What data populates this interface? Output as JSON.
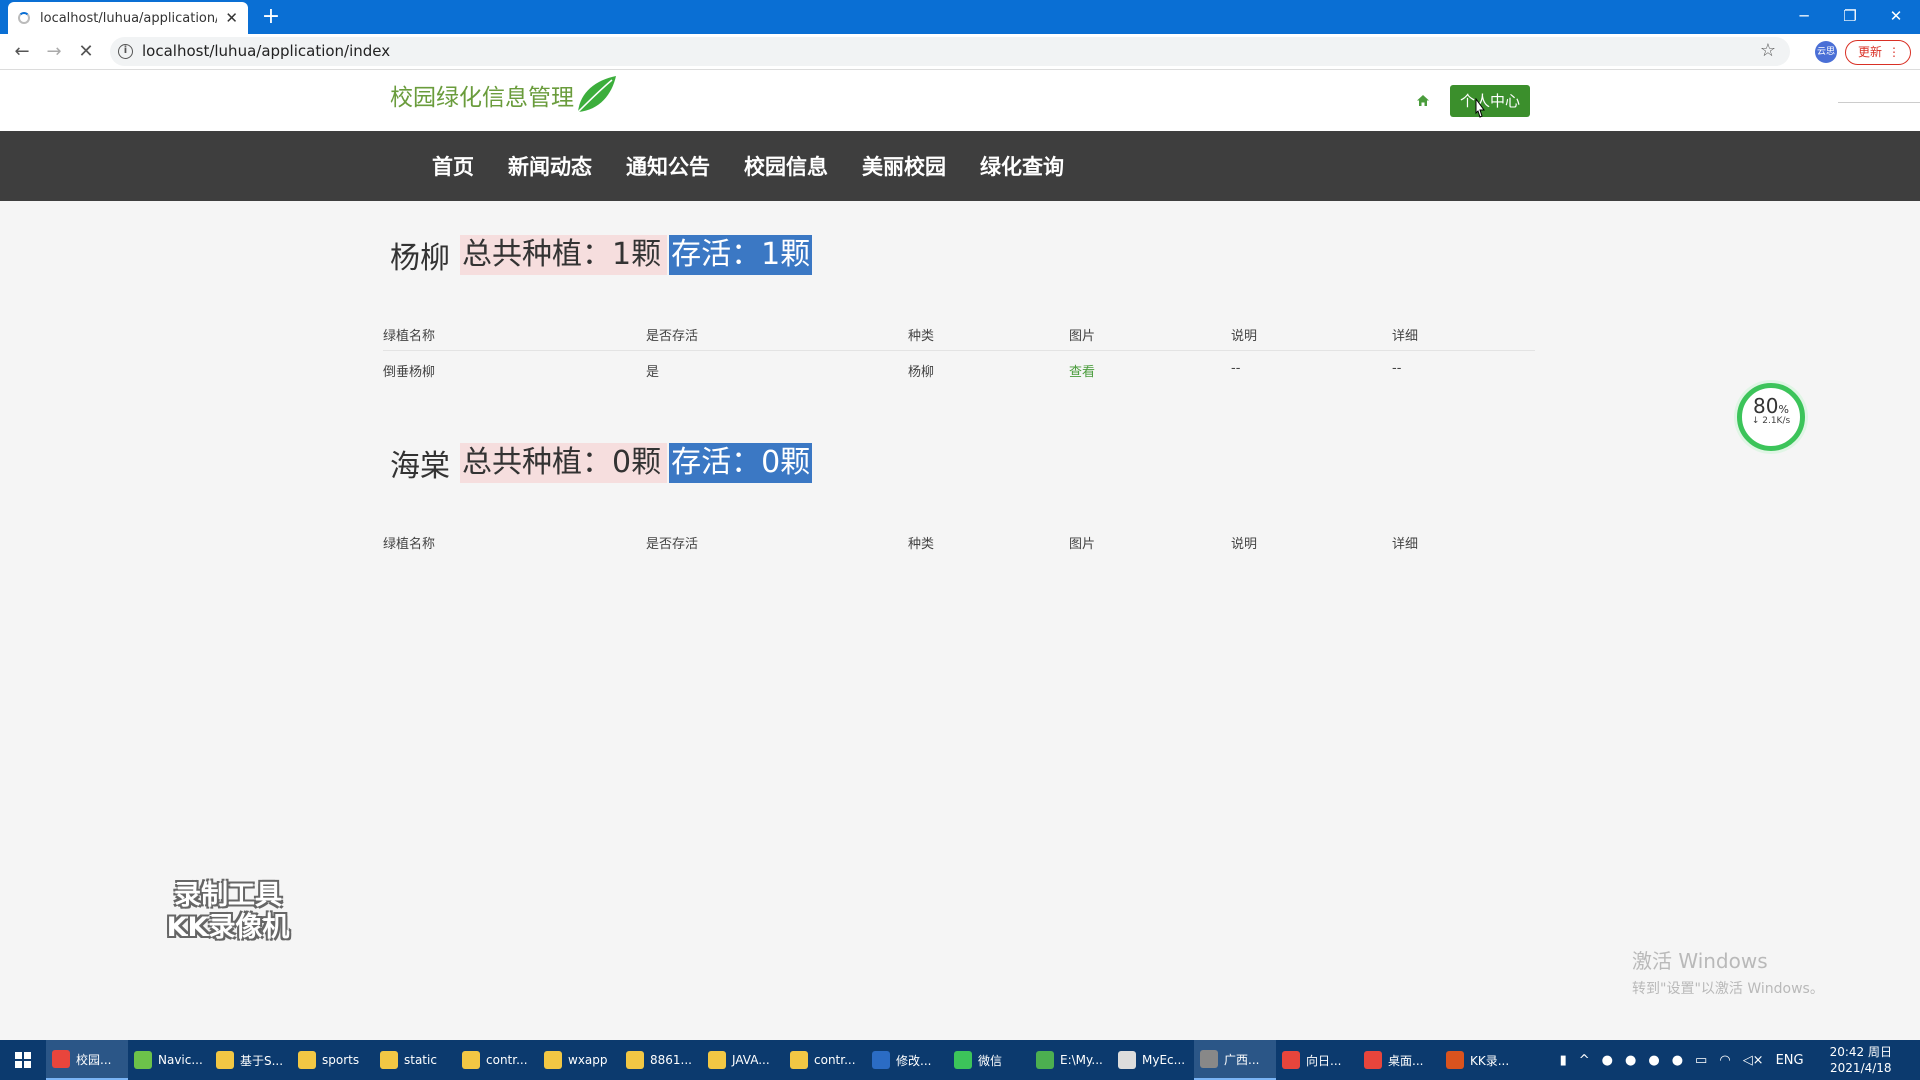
{
  "browser": {
    "tab_title": "localhost/luhua/application/in",
    "url": "localhost/luhua/application/index",
    "update_label": "更新",
    "profile_label": "云思"
  },
  "site": {
    "logo_text": "校园绿化信息管理",
    "profile_center_label": "个人中心"
  },
  "nav": [
    {
      "label": "首页"
    },
    {
      "label": "新闻动态"
    },
    {
      "label": "通知公告"
    },
    {
      "label": "校园信息"
    },
    {
      "label": "美丽校园"
    },
    {
      "label": "绿化查询"
    }
  ],
  "table_headers": [
    "绿植名称",
    "是否存活",
    "种类",
    "图片",
    "说明",
    "详细"
  ],
  "groups": [
    {
      "name": "杨柳",
      "total": "总共种植：1颗",
      "alive": "存活：1颗",
      "rows": [
        {
          "name": "倒垂杨柳",
          "alive": "是",
          "kind": "杨柳",
          "image": "查看",
          "desc": "--",
          "detail": "--"
        }
      ]
    },
    {
      "name": "海棠",
      "total": "总共种植：0颗",
      "alive": "存活：0颗",
      "rows": []
    }
  ],
  "speed_widget": {
    "percent": "80",
    "percent_sign": "%",
    "rate": "↓ 2.1K/s"
  },
  "watermark": {
    "line1": "录制工具",
    "line2": "KK录像机"
  },
  "activation": {
    "line1": "激活 Windows",
    "line2": "转到\"设置\"以激活 Windows。"
  },
  "taskbar": {
    "items": [
      {
        "label": "校园...",
        "color": "#e8453c",
        "active": true
      },
      {
        "label": "Navic...",
        "color": "#6cc24a",
        "active": false
      },
      {
        "label": "基于S...",
        "color": "#f2c744",
        "active": false
      },
      {
        "label": "sports",
        "color": "#f2c744",
        "active": false
      },
      {
        "label": "static",
        "color": "#f2c744",
        "active": false
      },
      {
        "label": "contr...",
        "color": "#f2c744",
        "active": false
      },
      {
        "label": "wxapp",
        "color": "#f2c744",
        "active": false
      },
      {
        "label": "8861...",
        "color": "#f2c744",
        "active": false
      },
      {
        "label": "JAVA...",
        "color": "#f2c744",
        "active": false
      },
      {
        "label": "contr...",
        "color": "#f2c744",
        "active": false
      },
      {
        "label": "修改...",
        "color": "#2b6cc4",
        "active": false
      },
      {
        "label": "微信",
        "color": "#3cc45a",
        "active": false
      },
      {
        "label": "E:\\My...",
        "color": "#4caf50",
        "active": false
      },
      {
        "label": "MyEc...",
        "color": "#dddddd",
        "active": false
      },
      {
        "label": "广西...",
        "color": "#888888",
        "active": true
      },
      {
        "label": "向日...",
        "color": "#e8453c",
        "active": false
      },
      {
        "label": "桌面...",
        "color": "#e8453c",
        "active": false
      },
      {
        "label": "KK录...",
        "color": "#d9531e",
        "active": false
      }
    ],
    "lang": "ENG",
    "time": "20:42 周日",
    "date": "2021/4/18"
  },
  "colors": {
    "tabstrip": "#0a6fd4",
    "nav_bg": "#3e3e3e",
    "brand_green": "#6a9c3c",
    "button_green": "#3b8f2c",
    "highlight_blue": "#3b78c4",
    "highlight_pink": "#f6dede"
  }
}
